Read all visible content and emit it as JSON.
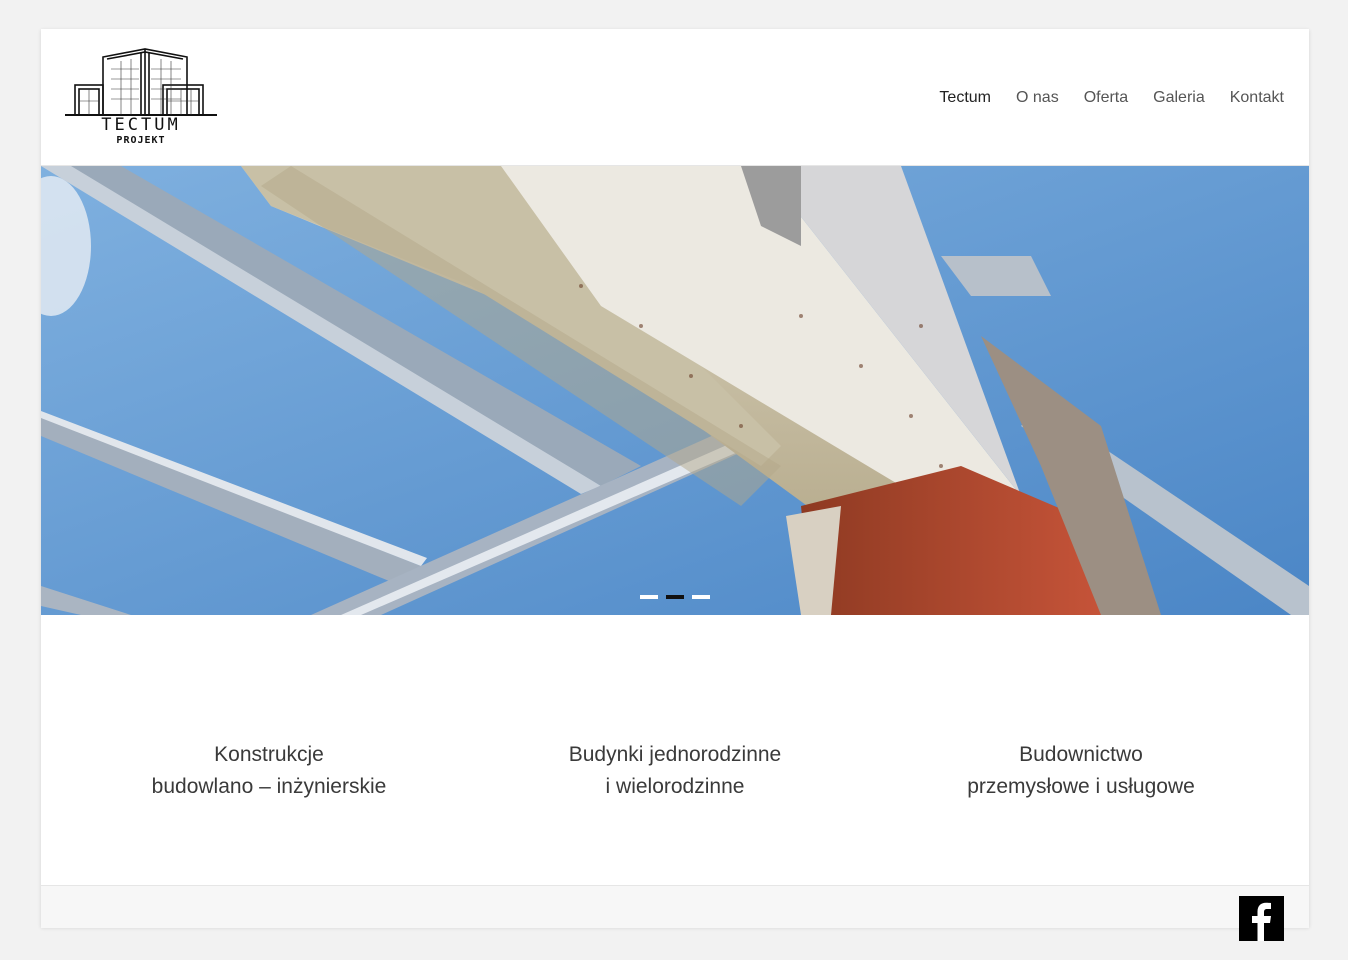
{
  "brand": {
    "logo_word": "TECTUM",
    "logo_sub": "PROJEKT"
  },
  "nav": {
    "items": [
      {
        "label": "Tectum",
        "active": true
      },
      {
        "label": "O nas"
      },
      {
        "label": "Oferta"
      },
      {
        "label": "Galeria"
      },
      {
        "label": "Kontakt"
      }
    ]
  },
  "slider": {
    "slide_count": 3,
    "active_index": 1
  },
  "features": [
    {
      "line1": "Konstrukcje",
      "line2": "budowlano – inżynierskie"
    },
    {
      "line1": "Budynki jednorodzinne",
      "line2": "i wielorodzinne"
    },
    {
      "line1": "Budownictwo",
      "line2": "przemysłowe i usługowe"
    }
  ],
  "social": {
    "facebook_icon": "facebook-icon"
  }
}
